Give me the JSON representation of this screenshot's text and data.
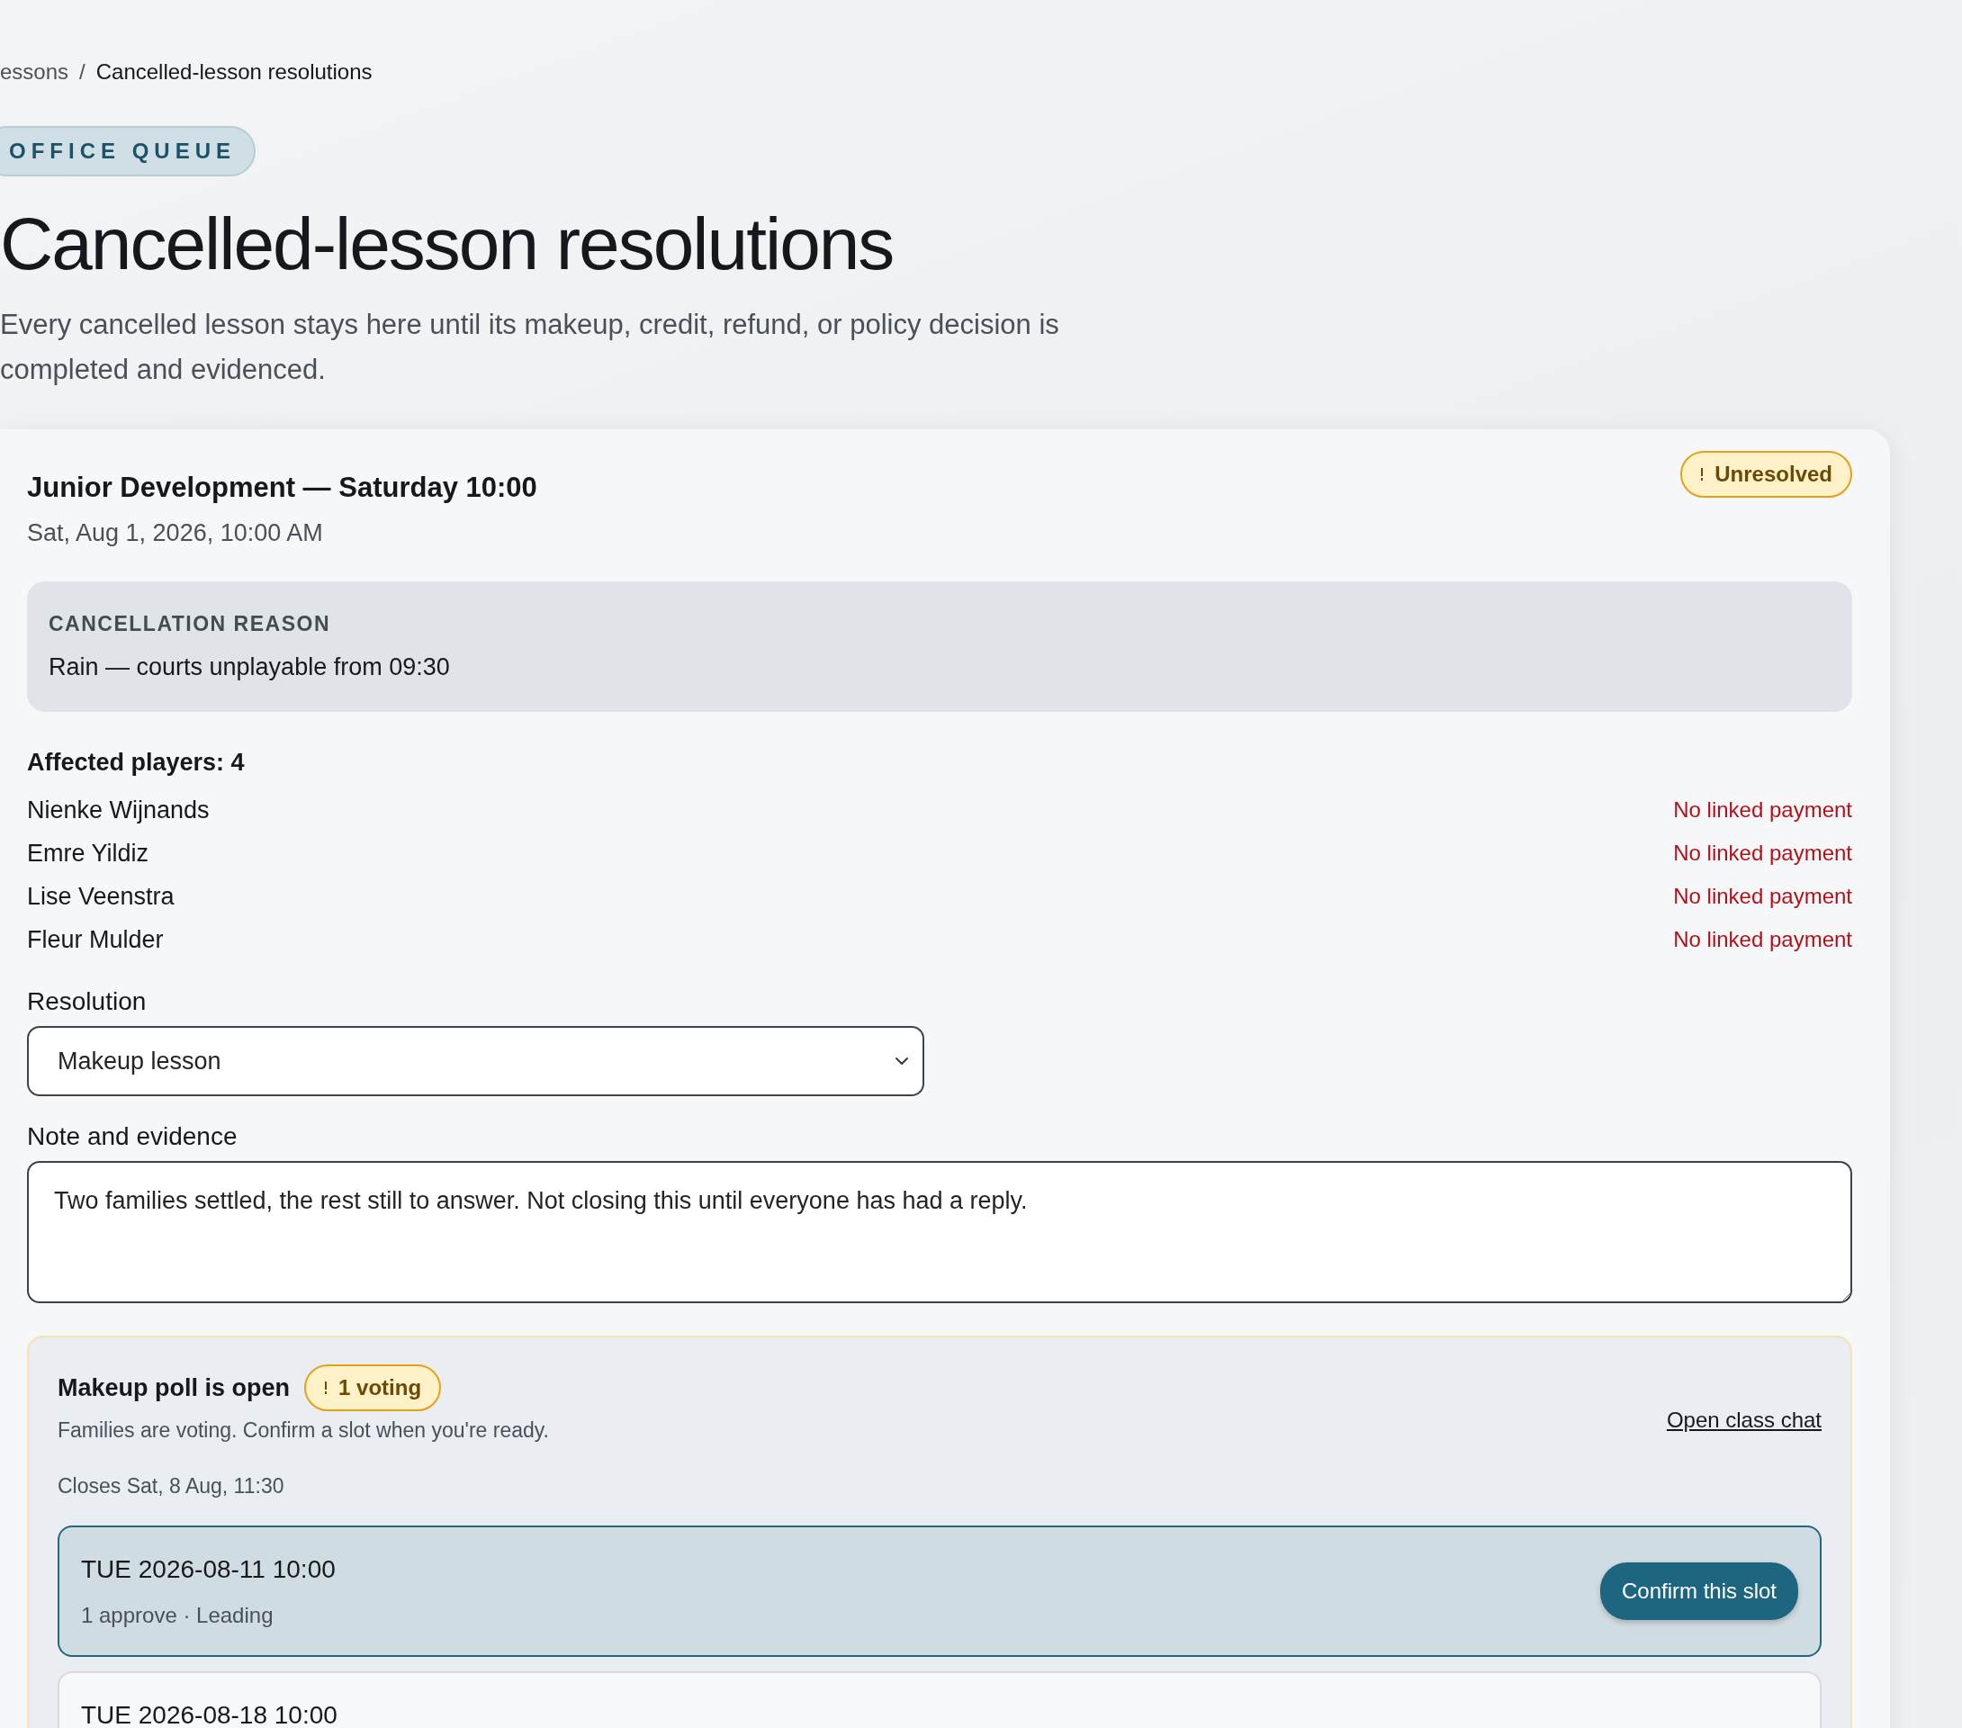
{
  "breadcrumb_separator": "/",
  "breadcrumb": [
    {
      "label": "essons",
      "current": false
    },
    {
      "label": "Cancelled-lesson resolutions",
      "current": true
    }
  ],
  "eyebrow": "OFFICE QUEUE",
  "title": "Cancelled-lesson resolutions",
  "intro": "Every cancelled lesson stays here until its makeup, credit, refund, or policy decision is completed and evidenced.",
  "lesson": {
    "title": "Junior Development — Saturday 10:00",
    "date": "Sat, Aug 1, 2026, 10:00 AM",
    "status": {
      "label": "Unresolved",
      "kind": "warning"
    },
    "reason": {
      "label": "CANCELLATION REASON",
      "text": "Rain — courts unplayable from 09:30"
    },
    "affected_label": "Affected players: 4",
    "players": [
      {
        "name": "Nienke Wijnands",
        "payment": "No linked payment",
        "kind": "missing"
      },
      {
        "name": "Emre Yildiz",
        "payment": "No linked payment",
        "kind": "missing"
      },
      {
        "name": "Lise Veenstra",
        "payment": "No linked payment",
        "kind": "missing"
      },
      {
        "name": "Fleur Mulder",
        "payment": "No linked payment",
        "kind": "missing"
      }
    ],
    "resolution": {
      "label": "Resolution",
      "value": "Makeup lesson"
    },
    "note": {
      "label": "Note and evidence",
      "value": "Two families settled, the rest still to answer. Not closing this until everyone has had a reply."
    },
    "poll": {
      "title": "Makeup poll is open",
      "badge": {
        "label": "1 voting",
        "kind": "warning"
      },
      "subtitle": "Families are voting. Confirm a slot when you're ready.",
      "chat_link": "Open class chat",
      "closes": "Closes Sat, 8 Aug, 11:30",
      "slots": [
        {
          "date": "TUE 2026-08-11 10:00",
          "detail": "1 approve · Leading",
          "selected": true,
          "action": "Confirm this slot"
        },
        {
          "date": "TUE 2026-08-18 10:00",
          "selected": false
        }
      ]
    }
  }
}
